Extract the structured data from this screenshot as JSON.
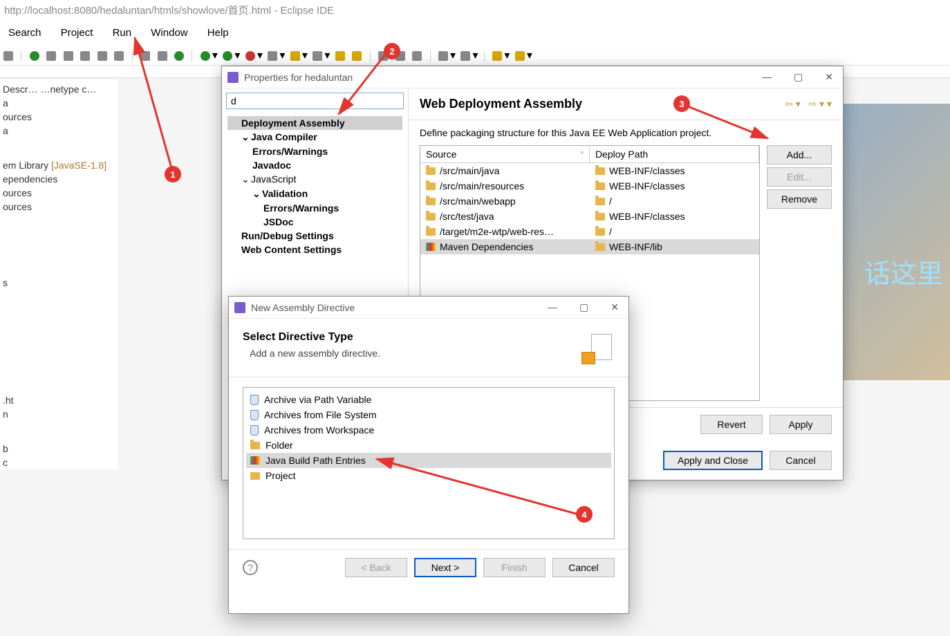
{
  "title": "http://localhost:8080/hedaluntan/htmls/showlove/首页.html - Eclipse IDE",
  "menus": [
    "Search",
    "Project",
    "Run",
    "Window",
    "Help"
  ],
  "leftPanel": {
    "items": [
      "",
      "Descr…    …netype c…",
      "a",
      "ources",
      "a",
      "",
      "em Library ",
      "ependencies",
      "ources",
      "ources"
    ],
    "bracket": "[JavaSE-1.8]",
    "extras": [
      "s",
      "",
      ".ht",
      "n",
      "b",
      "c"
    ]
  },
  "properties": {
    "title": "Properties for hedaluntan",
    "filter": "d",
    "tree": {
      "deployment": "Deployment Assembly",
      "javaCompiler": "Java Compiler",
      "errWarn": "Errors/Warnings",
      "javadoc": "Javadoc",
      "javascript": "JavaScript",
      "validation": "Validation",
      "jsErrWarn": "Errors/Warnings",
      "jsdoc": "JSDoc",
      "runDebug": "Run/Debug Settings",
      "webContent": "Web Content Settings"
    },
    "section": {
      "title": "Web Deployment Assembly",
      "desc": "Define packaging structure for this Java EE Web Application project."
    },
    "table": {
      "headers": {
        "source": "Source",
        "deploy": "Deploy Path"
      },
      "rows": [
        {
          "src": "/src/main/java",
          "dep": "WEB-INF/classes",
          "icon": "folder"
        },
        {
          "src": "/src/main/resources",
          "dep": "WEB-INF/classes",
          "icon": "folder"
        },
        {
          "src": "/src/main/webapp",
          "dep": "/",
          "icon": "folder"
        },
        {
          "src": "/src/test/java",
          "dep": "WEB-INF/classes",
          "icon": "folder"
        },
        {
          "src": "/target/m2e-wtp/web-res…",
          "dep": "/",
          "icon": "folder"
        },
        {
          "src": "Maven Dependencies",
          "dep": "WEB-INF/lib",
          "icon": "jar",
          "selected": true
        }
      ]
    },
    "buttons": {
      "add": "Add...",
      "edit": "Edit...",
      "remove": "Remove",
      "revert": "Revert",
      "apply": "Apply",
      "applyClose": "Apply and Close",
      "cancel": "Cancel"
    }
  },
  "assembly": {
    "title": "New Assembly Directive",
    "header": "Select Directive Type",
    "sub": "Add a new assembly directive.",
    "items": [
      {
        "label": "Archive via Path Variable",
        "icon": "arc"
      },
      {
        "label": "Archives from File System",
        "icon": "arc"
      },
      {
        "label": "Archives from Workspace",
        "icon": "arc"
      },
      {
        "label": "Folder",
        "icon": "folder"
      },
      {
        "label": "Java Build Path Entries",
        "icon": "jar",
        "selected": true
      },
      {
        "label": "Project",
        "icon": "proj"
      }
    ],
    "buttons": {
      "back": "< Back",
      "next": "Next >",
      "finish": "Finish",
      "cancel": "Cancel"
    }
  },
  "annotations": {
    "m1": "1",
    "m2": "2",
    "m3": "3",
    "m4": "4"
  },
  "bgText": "话这里"
}
